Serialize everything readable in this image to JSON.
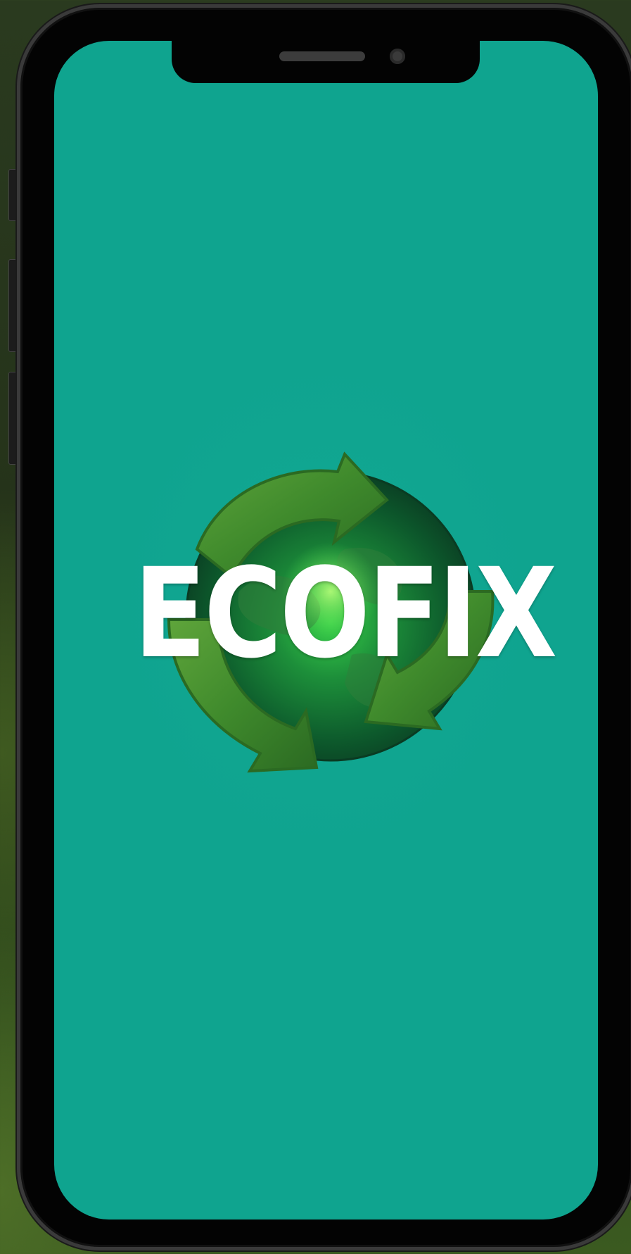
{
  "app": {
    "logo_text": "ECOFIX",
    "screen_color": "#0fa48f",
    "logo_icon": "recycling-globe-icon"
  },
  "device": {
    "frame_color": "#030303"
  }
}
